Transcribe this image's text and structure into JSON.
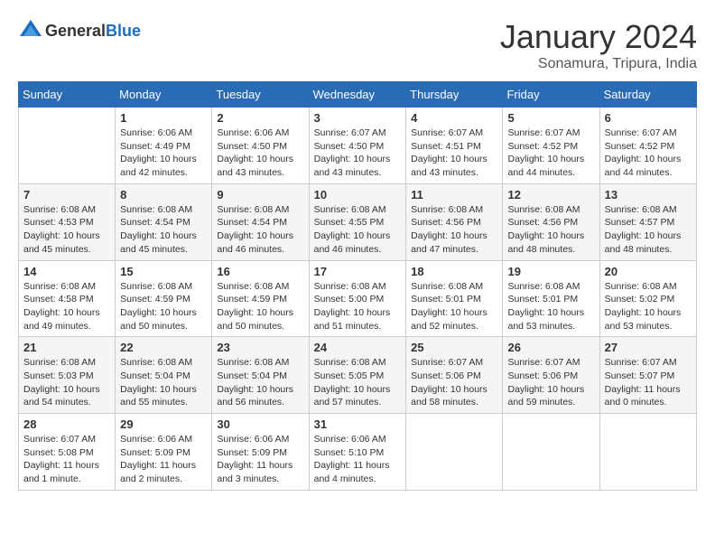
{
  "header": {
    "logo_general": "General",
    "logo_blue": "Blue",
    "month": "January 2024",
    "location": "Sonamura, Tripura, India"
  },
  "weekdays": [
    "Sunday",
    "Monday",
    "Tuesday",
    "Wednesday",
    "Thursday",
    "Friday",
    "Saturday"
  ],
  "weeks": [
    [
      {
        "day": "",
        "sunrise": "",
        "sunset": "",
        "daylight": ""
      },
      {
        "day": "1",
        "sunrise": "Sunrise: 6:06 AM",
        "sunset": "Sunset: 4:49 PM",
        "daylight": "Daylight: 10 hours and 42 minutes."
      },
      {
        "day": "2",
        "sunrise": "Sunrise: 6:06 AM",
        "sunset": "Sunset: 4:50 PM",
        "daylight": "Daylight: 10 hours and 43 minutes."
      },
      {
        "day": "3",
        "sunrise": "Sunrise: 6:07 AM",
        "sunset": "Sunset: 4:50 PM",
        "daylight": "Daylight: 10 hours and 43 minutes."
      },
      {
        "day": "4",
        "sunrise": "Sunrise: 6:07 AM",
        "sunset": "Sunset: 4:51 PM",
        "daylight": "Daylight: 10 hours and 43 minutes."
      },
      {
        "day": "5",
        "sunrise": "Sunrise: 6:07 AM",
        "sunset": "Sunset: 4:52 PM",
        "daylight": "Daylight: 10 hours and 44 minutes."
      },
      {
        "day": "6",
        "sunrise": "Sunrise: 6:07 AM",
        "sunset": "Sunset: 4:52 PM",
        "daylight": "Daylight: 10 hours and 44 minutes."
      }
    ],
    [
      {
        "day": "7",
        "sunrise": "Sunrise: 6:08 AM",
        "sunset": "Sunset: 4:53 PM",
        "daylight": "Daylight: 10 hours and 45 minutes."
      },
      {
        "day": "8",
        "sunrise": "Sunrise: 6:08 AM",
        "sunset": "Sunset: 4:54 PM",
        "daylight": "Daylight: 10 hours and 45 minutes."
      },
      {
        "day": "9",
        "sunrise": "Sunrise: 6:08 AM",
        "sunset": "Sunset: 4:54 PM",
        "daylight": "Daylight: 10 hours and 46 minutes."
      },
      {
        "day": "10",
        "sunrise": "Sunrise: 6:08 AM",
        "sunset": "Sunset: 4:55 PM",
        "daylight": "Daylight: 10 hours and 46 minutes."
      },
      {
        "day": "11",
        "sunrise": "Sunrise: 6:08 AM",
        "sunset": "Sunset: 4:56 PM",
        "daylight": "Daylight: 10 hours and 47 minutes."
      },
      {
        "day": "12",
        "sunrise": "Sunrise: 6:08 AM",
        "sunset": "Sunset: 4:56 PM",
        "daylight": "Daylight: 10 hours and 48 minutes."
      },
      {
        "day": "13",
        "sunrise": "Sunrise: 6:08 AM",
        "sunset": "Sunset: 4:57 PM",
        "daylight": "Daylight: 10 hours and 48 minutes."
      }
    ],
    [
      {
        "day": "14",
        "sunrise": "Sunrise: 6:08 AM",
        "sunset": "Sunset: 4:58 PM",
        "daylight": "Daylight: 10 hours and 49 minutes."
      },
      {
        "day": "15",
        "sunrise": "Sunrise: 6:08 AM",
        "sunset": "Sunset: 4:59 PM",
        "daylight": "Daylight: 10 hours and 50 minutes."
      },
      {
        "day": "16",
        "sunrise": "Sunrise: 6:08 AM",
        "sunset": "Sunset: 4:59 PM",
        "daylight": "Daylight: 10 hours and 50 minutes."
      },
      {
        "day": "17",
        "sunrise": "Sunrise: 6:08 AM",
        "sunset": "Sunset: 5:00 PM",
        "daylight": "Daylight: 10 hours and 51 minutes."
      },
      {
        "day": "18",
        "sunrise": "Sunrise: 6:08 AM",
        "sunset": "Sunset: 5:01 PM",
        "daylight": "Daylight: 10 hours and 52 minutes."
      },
      {
        "day": "19",
        "sunrise": "Sunrise: 6:08 AM",
        "sunset": "Sunset: 5:01 PM",
        "daylight": "Daylight: 10 hours and 53 minutes."
      },
      {
        "day": "20",
        "sunrise": "Sunrise: 6:08 AM",
        "sunset": "Sunset: 5:02 PM",
        "daylight": "Daylight: 10 hours and 53 minutes."
      }
    ],
    [
      {
        "day": "21",
        "sunrise": "Sunrise: 6:08 AM",
        "sunset": "Sunset: 5:03 PM",
        "daylight": "Daylight: 10 hours and 54 minutes."
      },
      {
        "day": "22",
        "sunrise": "Sunrise: 6:08 AM",
        "sunset": "Sunset: 5:04 PM",
        "daylight": "Daylight: 10 hours and 55 minutes."
      },
      {
        "day": "23",
        "sunrise": "Sunrise: 6:08 AM",
        "sunset": "Sunset: 5:04 PM",
        "daylight": "Daylight: 10 hours and 56 minutes."
      },
      {
        "day": "24",
        "sunrise": "Sunrise: 6:08 AM",
        "sunset": "Sunset: 5:05 PM",
        "daylight": "Daylight: 10 hours and 57 minutes."
      },
      {
        "day": "25",
        "sunrise": "Sunrise: 6:07 AM",
        "sunset": "Sunset: 5:06 PM",
        "daylight": "Daylight: 10 hours and 58 minutes."
      },
      {
        "day": "26",
        "sunrise": "Sunrise: 6:07 AM",
        "sunset": "Sunset: 5:06 PM",
        "daylight": "Daylight: 10 hours and 59 minutes."
      },
      {
        "day": "27",
        "sunrise": "Sunrise: 6:07 AM",
        "sunset": "Sunset: 5:07 PM",
        "daylight": "Daylight: 11 hours and 0 minutes."
      }
    ],
    [
      {
        "day": "28",
        "sunrise": "Sunrise: 6:07 AM",
        "sunset": "Sunset: 5:08 PM",
        "daylight": "Daylight: 11 hours and 1 minute."
      },
      {
        "day": "29",
        "sunrise": "Sunrise: 6:06 AM",
        "sunset": "Sunset: 5:09 PM",
        "daylight": "Daylight: 11 hours and 2 minutes."
      },
      {
        "day": "30",
        "sunrise": "Sunrise: 6:06 AM",
        "sunset": "Sunset: 5:09 PM",
        "daylight": "Daylight: 11 hours and 3 minutes."
      },
      {
        "day": "31",
        "sunrise": "Sunrise: 6:06 AM",
        "sunset": "Sunset: 5:10 PM",
        "daylight": "Daylight: 11 hours and 4 minutes."
      },
      {
        "day": "",
        "sunrise": "",
        "sunset": "",
        "daylight": ""
      },
      {
        "day": "",
        "sunrise": "",
        "sunset": "",
        "daylight": ""
      },
      {
        "day": "",
        "sunrise": "",
        "sunset": "",
        "daylight": ""
      }
    ]
  ]
}
